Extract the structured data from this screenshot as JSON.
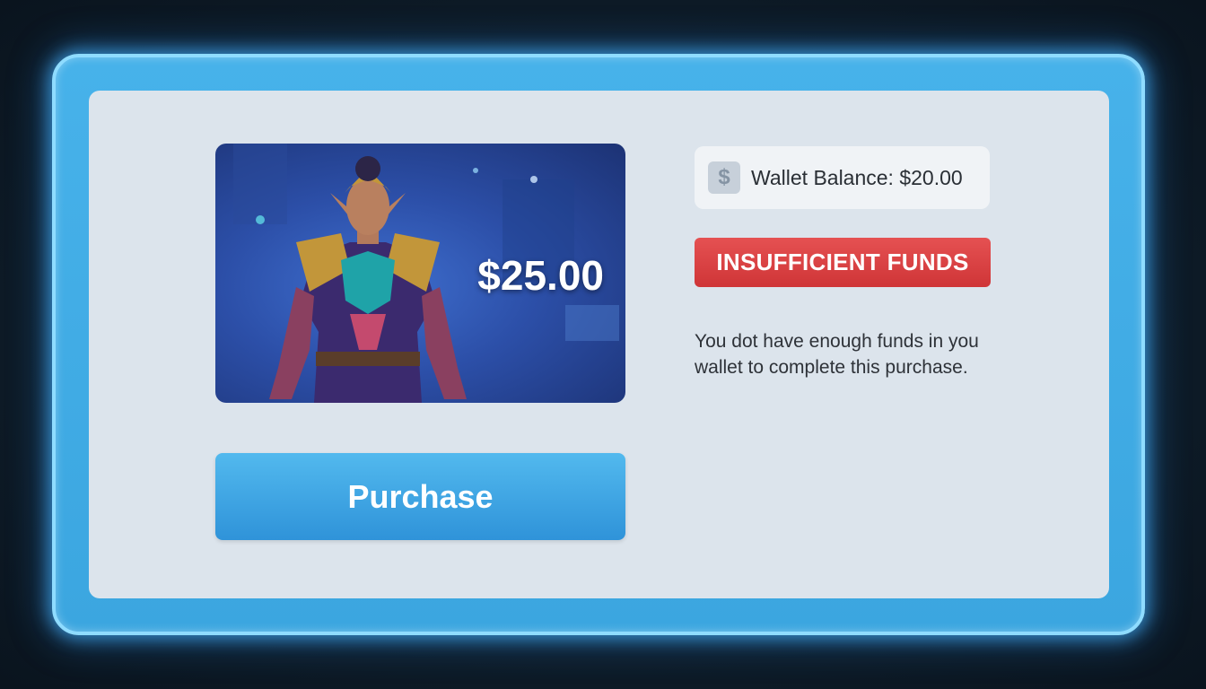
{
  "product": {
    "price": "$25.00",
    "image_alt": "armored elf warrior character skin"
  },
  "actions": {
    "purchase_label": "Purchase"
  },
  "wallet": {
    "icon": "dollar-icon",
    "icon_glyph": "$",
    "label": "Wallet Balance: $20.00"
  },
  "status": {
    "label": "INSUFFICIENT FUNDS",
    "color": "#d83c3e",
    "message": "You dot have enough funds in you wallet to complete this purchase."
  },
  "colors": {
    "frame": "#3ba6e0",
    "panel": "#dce4ec",
    "button": "#3fa6e3"
  }
}
